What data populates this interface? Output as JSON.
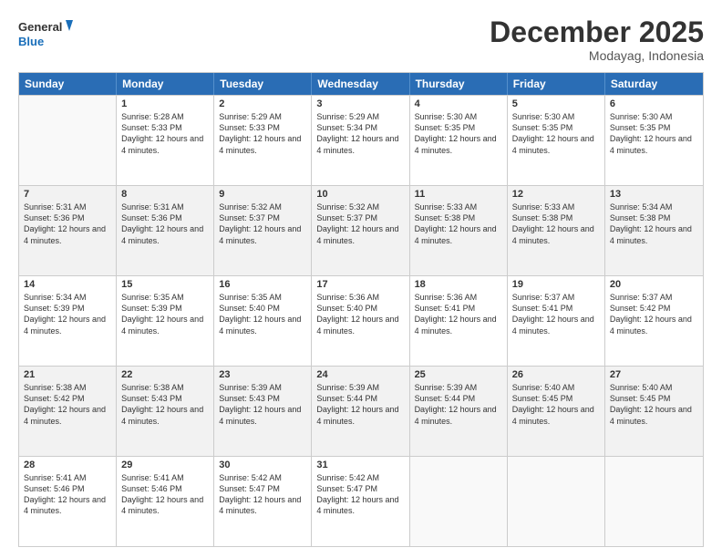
{
  "logo": {
    "line1": "General",
    "line2": "Blue"
  },
  "title": "December 2025",
  "location": "Modayag, Indonesia",
  "days_of_week": [
    "Sunday",
    "Monday",
    "Tuesday",
    "Wednesday",
    "Thursday",
    "Friday",
    "Saturday"
  ],
  "weeks": [
    [
      {
        "day": "",
        "sunrise": "",
        "sunset": "",
        "daylight": ""
      },
      {
        "day": "1",
        "sunrise": "Sunrise: 5:28 AM",
        "sunset": "Sunset: 5:33 PM",
        "daylight": "Daylight: 12 hours and 4 minutes."
      },
      {
        "day": "2",
        "sunrise": "Sunrise: 5:29 AM",
        "sunset": "Sunset: 5:33 PM",
        "daylight": "Daylight: 12 hours and 4 minutes."
      },
      {
        "day": "3",
        "sunrise": "Sunrise: 5:29 AM",
        "sunset": "Sunset: 5:34 PM",
        "daylight": "Daylight: 12 hours and 4 minutes."
      },
      {
        "day": "4",
        "sunrise": "Sunrise: 5:30 AM",
        "sunset": "Sunset: 5:35 PM",
        "daylight": "Daylight: 12 hours and 4 minutes."
      },
      {
        "day": "5",
        "sunrise": "Sunrise: 5:30 AM",
        "sunset": "Sunset: 5:35 PM",
        "daylight": "Daylight: 12 hours and 4 minutes."
      },
      {
        "day": "6",
        "sunrise": "Sunrise: 5:30 AM",
        "sunset": "Sunset: 5:35 PM",
        "daylight": "Daylight: 12 hours and 4 minutes."
      }
    ],
    [
      {
        "day": "7",
        "sunrise": "Sunrise: 5:31 AM",
        "sunset": "Sunset: 5:36 PM",
        "daylight": "Daylight: 12 hours and 4 minutes."
      },
      {
        "day": "8",
        "sunrise": "Sunrise: 5:31 AM",
        "sunset": "Sunset: 5:36 PM",
        "daylight": "Daylight: 12 hours and 4 minutes."
      },
      {
        "day": "9",
        "sunrise": "Sunrise: 5:32 AM",
        "sunset": "Sunset: 5:37 PM",
        "daylight": "Daylight: 12 hours and 4 minutes."
      },
      {
        "day": "10",
        "sunrise": "Sunrise: 5:32 AM",
        "sunset": "Sunset: 5:37 PM",
        "daylight": "Daylight: 12 hours and 4 minutes."
      },
      {
        "day": "11",
        "sunrise": "Sunrise: 5:33 AM",
        "sunset": "Sunset: 5:38 PM",
        "daylight": "Daylight: 12 hours and 4 minutes."
      },
      {
        "day": "12",
        "sunrise": "Sunrise: 5:33 AM",
        "sunset": "Sunset: 5:38 PM",
        "daylight": "Daylight: 12 hours and 4 minutes."
      },
      {
        "day": "13",
        "sunrise": "Sunrise: 5:34 AM",
        "sunset": "Sunset: 5:38 PM",
        "daylight": "Daylight: 12 hours and 4 minutes."
      }
    ],
    [
      {
        "day": "14",
        "sunrise": "Sunrise: 5:34 AM",
        "sunset": "Sunset: 5:39 PM",
        "daylight": "Daylight: 12 hours and 4 minutes."
      },
      {
        "day": "15",
        "sunrise": "Sunrise: 5:35 AM",
        "sunset": "Sunset: 5:39 PM",
        "daylight": "Daylight: 12 hours and 4 minutes."
      },
      {
        "day": "16",
        "sunrise": "Sunrise: 5:35 AM",
        "sunset": "Sunset: 5:40 PM",
        "daylight": "Daylight: 12 hours and 4 minutes."
      },
      {
        "day": "17",
        "sunrise": "Sunrise: 5:36 AM",
        "sunset": "Sunset: 5:40 PM",
        "daylight": "Daylight: 12 hours and 4 minutes."
      },
      {
        "day": "18",
        "sunrise": "Sunrise: 5:36 AM",
        "sunset": "Sunset: 5:41 PM",
        "daylight": "Daylight: 12 hours and 4 minutes."
      },
      {
        "day": "19",
        "sunrise": "Sunrise: 5:37 AM",
        "sunset": "Sunset: 5:41 PM",
        "daylight": "Daylight: 12 hours and 4 minutes."
      },
      {
        "day": "20",
        "sunrise": "Sunrise: 5:37 AM",
        "sunset": "Sunset: 5:42 PM",
        "daylight": "Daylight: 12 hours and 4 minutes."
      }
    ],
    [
      {
        "day": "21",
        "sunrise": "Sunrise: 5:38 AM",
        "sunset": "Sunset: 5:42 PM",
        "daylight": "Daylight: 12 hours and 4 minutes."
      },
      {
        "day": "22",
        "sunrise": "Sunrise: 5:38 AM",
        "sunset": "Sunset: 5:43 PM",
        "daylight": "Daylight: 12 hours and 4 minutes."
      },
      {
        "day": "23",
        "sunrise": "Sunrise: 5:39 AM",
        "sunset": "Sunset: 5:43 PM",
        "daylight": "Daylight: 12 hours and 4 minutes."
      },
      {
        "day": "24",
        "sunrise": "Sunrise: 5:39 AM",
        "sunset": "Sunset: 5:44 PM",
        "daylight": "Daylight: 12 hours and 4 minutes."
      },
      {
        "day": "25",
        "sunrise": "Sunrise: 5:39 AM",
        "sunset": "Sunset: 5:44 PM",
        "daylight": "Daylight: 12 hours and 4 minutes."
      },
      {
        "day": "26",
        "sunrise": "Sunrise: 5:40 AM",
        "sunset": "Sunset: 5:45 PM",
        "daylight": "Daylight: 12 hours and 4 minutes."
      },
      {
        "day": "27",
        "sunrise": "Sunrise: 5:40 AM",
        "sunset": "Sunset: 5:45 PM",
        "daylight": "Daylight: 12 hours and 4 minutes."
      }
    ],
    [
      {
        "day": "28",
        "sunrise": "Sunrise: 5:41 AM",
        "sunset": "Sunset: 5:46 PM",
        "daylight": "Daylight: 12 hours and 4 minutes."
      },
      {
        "day": "29",
        "sunrise": "Sunrise: 5:41 AM",
        "sunset": "Sunset: 5:46 PM",
        "daylight": "Daylight: 12 hours and 4 minutes."
      },
      {
        "day": "30",
        "sunrise": "Sunrise: 5:42 AM",
        "sunset": "Sunset: 5:47 PM",
        "daylight": "Daylight: 12 hours and 4 minutes."
      },
      {
        "day": "31",
        "sunrise": "Sunrise: 5:42 AM",
        "sunset": "Sunset: 5:47 PM",
        "daylight": "Daylight: 12 hours and 4 minutes."
      },
      {
        "day": "",
        "sunrise": "",
        "sunset": "",
        "daylight": ""
      },
      {
        "day": "",
        "sunrise": "",
        "sunset": "",
        "daylight": ""
      },
      {
        "day": "",
        "sunrise": "",
        "sunset": "",
        "daylight": ""
      }
    ]
  ]
}
